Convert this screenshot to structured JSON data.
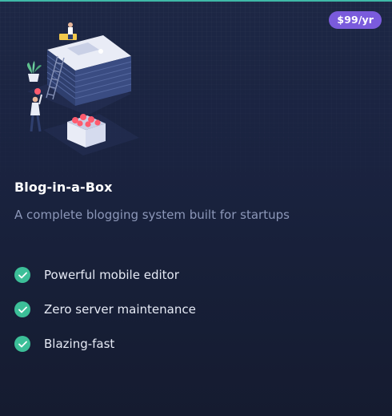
{
  "price": {
    "label": "$99/yr"
  },
  "product": {
    "title": "Blog-in-a-Box",
    "subtitle": "A complete blogging system built for startups"
  },
  "features": [
    {
      "label": "Powerful mobile editor",
      "icon": "check-icon"
    },
    {
      "label": "Zero server maintenance",
      "icon": "check-icon"
    },
    {
      "label": "Blazing-fast",
      "icon": "check-icon"
    }
  ],
  "colors": {
    "accent": "#7a5bdc",
    "check": "#3cbf98",
    "background": "#1a2340",
    "top_border": "#3fb9a8"
  }
}
